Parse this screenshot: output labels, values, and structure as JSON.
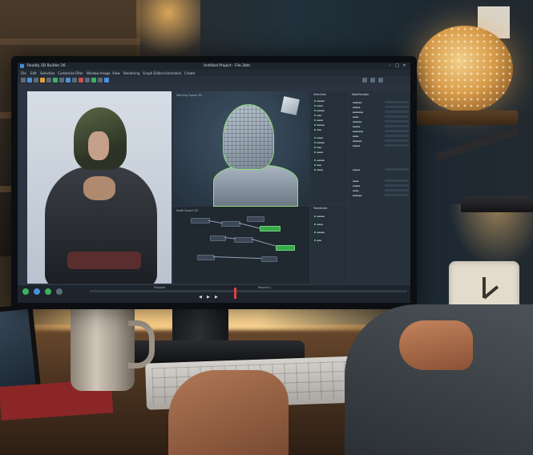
{
  "app": {
    "name": "Reality 3D Builder 26",
    "window_title": "Untitled Project - File.3dm"
  },
  "menu": [
    "File",
    "Edit",
    "Selection",
    "Customize",
    "Filter",
    "Window",
    "Image",
    "View",
    "Rendering",
    "Graph Editors",
    "Animation",
    "Create"
  ],
  "viewport": {
    "center_label": "Working Space 3D",
    "node_editor_label": "Node Space 2D"
  },
  "panels": {
    "selection_title": "Selection",
    "modification_title": "Modification",
    "transform_title": "Transform"
  },
  "timeline": {
    "label": "Playback",
    "marker_label": "Reserve 2"
  }
}
